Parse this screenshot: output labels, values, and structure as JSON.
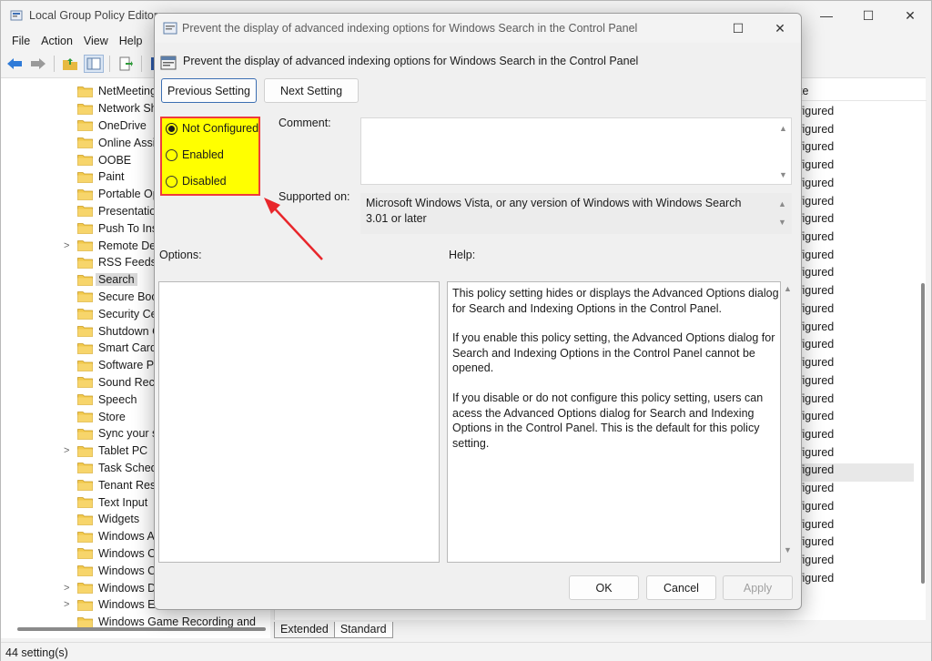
{
  "main_window": {
    "title": "Local Group Policy Editor",
    "menu": [
      "File",
      "Action",
      "View",
      "Help"
    ],
    "status": "44 setting(s)",
    "tabs": [
      "Extended",
      "Standard"
    ],
    "state_header": "te",
    "state_values": [
      "figured",
      "figured",
      "figured",
      "figured",
      "figured",
      "figured",
      "figured",
      "figured",
      "figured",
      "figured",
      "figured",
      "figured",
      "figured",
      "figured",
      "figured",
      "figured",
      "figured",
      "figured",
      "figured",
      "figured",
      "figured",
      "figured",
      "figured",
      "figured",
      "figured",
      "figured",
      "figured"
    ],
    "selected_state_row": 20
  },
  "tree": {
    "items": [
      {
        "label": "NetMeeting",
        "expander": ""
      },
      {
        "label": "Network Sh",
        "expander": ""
      },
      {
        "label": "OneDrive",
        "expander": ""
      },
      {
        "label": "Online Assi",
        "expander": ""
      },
      {
        "label": "OOBE",
        "expander": ""
      },
      {
        "label": "Paint",
        "expander": ""
      },
      {
        "label": "Portable Op",
        "expander": ""
      },
      {
        "label": "Presentation",
        "expander": ""
      },
      {
        "label": "Push To Inst",
        "expander": ""
      },
      {
        "label": "Remote Des",
        "expander": ">"
      },
      {
        "label": "RSS Feeds",
        "expander": ""
      },
      {
        "label": "Search",
        "expander": ""
      },
      {
        "label": "Secure Boot",
        "expander": ""
      },
      {
        "label": "Security Cer",
        "expander": ""
      },
      {
        "label": "Shutdown C",
        "expander": ""
      },
      {
        "label": "Smart Card",
        "expander": ""
      },
      {
        "label": "Software Pr",
        "expander": ""
      },
      {
        "label": "Sound Reco",
        "expander": ""
      },
      {
        "label": "Speech",
        "expander": ""
      },
      {
        "label": "Store",
        "expander": ""
      },
      {
        "label": "Sync your s",
        "expander": ""
      },
      {
        "label": "Tablet PC",
        "expander": ">"
      },
      {
        "label": "Task Schedu",
        "expander": ""
      },
      {
        "label": "Tenant Rest",
        "expander": ""
      },
      {
        "label": "Text Input",
        "expander": ""
      },
      {
        "label": "Widgets",
        "expander": ""
      },
      {
        "label": "Windows AI",
        "expander": ""
      },
      {
        "label": "Windows Ca",
        "expander": ""
      },
      {
        "label": "Windows Co",
        "expander": ""
      },
      {
        "label": "Windows De",
        "expander": ">"
      },
      {
        "label": "Windows Er",
        "expander": ">"
      },
      {
        "label": "Windows Game Recording and",
        "expander": ""
      }
    ],
    "selected": "Search"
  },
  "dialog": {
    "title": "Prevent the display of advanced indexing options for Windows Search in the Control Panel",
    "header": "Prevent the display of advanced indexing options for Windows Search in the Control Panel",
    "previous_label": "Previous Setting",
    "next_label": "Next Setting",
    "radio_options": [
      "Not Configured",
      "Enabled",
      "Disabled"
    ],
    "selected_radio": "Not Configured",
    "comment_label": "Comment:",
    "comment_value": "",
    "supported_label": "Supported on:",
    "supported_value": "Microsoft Windows Vista, or any version of Windows with Windows Search 3.01 or later",
    "options_label": "Options:",
    "help_label": "Help:",
    "help_paragraphs": [
      "This policy setting hides or displays the Advanced Options dialog for Search and Indexing Options in the Control Panel.",
      "If you enable this policy setting, the Advanced Options dialog for Search and Indexing Options in the Control Panel cannot be opened.",
      "If you disable or do not configure this policy setting, users can acess the Advanced Options dialog for Search and Indexing Options in the Control Panel. This is the default for this policy setting."
    ],
    "ok_label": "OK",
    "cancel_label": "Cancel",
    "apply_label": "Apply"
  },
  "colors": {
    "highlight_fill": "#ffff00",
    "highlight_border": "#ef3b3b",
    "annotation_arrow": "#e8262b",
    "folder": "#f2c94c"
  }
}
